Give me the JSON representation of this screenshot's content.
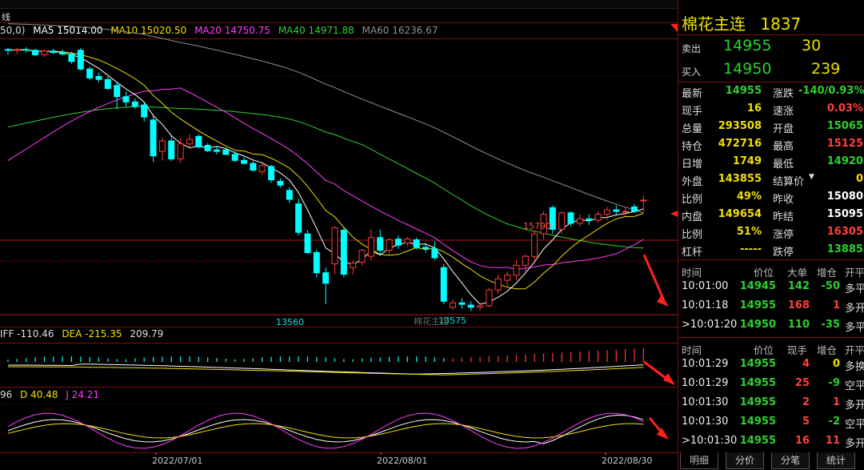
{
  "indicators": {
    "main_prefix": "50,0)",
    "ma5": "MA5 15014.00",
    "ma10": "MA10 15020.50",
    "ma20": "MA20 14750.75",
    "ma40": "MA40 14971.88",
    "ma60": "MA60 16236.67",
    "toolbar_text": "线",
    "macd_prefix": "IFF -110.46",
    "dea": "DEA -215.35",
    "macd": "209.79",
    "kdj_prefix": "96",
    "kdj_d": "D 40.48",
    "kdj_j": "J 24.21"
  },
  "annotations": {
    "high": "15790",
    "low1": "13560",
    "low2": "13575",
    "watermark": "棉花主连"
  },
  "dates": [
    "2022/07/01",
    "2022/08/01",
    "2022/08/30"
  ],
  "colors": {
    "up": "#ff3b3b",
    "down": "#00ffff",
    "ma5": "#ffffff",
    "ma10": "#f0e000",
    "ma20": "#ff3cff",
    "ma40": "#30d030",
    "ma60": "#909090",
    "border": "#7a1010"
  },
  "chart_data": {
    "type": "candlestick",
    "dates": [
      "2022/07/01",
      "2022/08/01",
      "2022/08/30"
    ],
    "candles": [
      [
        16960,
        16980,
        16890,
        16950
      ],
      [
        16950,
        16980,
        16900,
        16960
      ],
      [
        16960,
        16990,
        16920,
        16950
      ],
      [
        16950,
        16970,
        16870,
        16890
      ],
      [
        16890,
        16960,
        16860,
        16940
      ],
      [
        16940,
        16970,
        16900,
        16920
      ],
      [
        16920,
        16960,
        16880,
        16900
      ],
      [
        16900,
        16930,
        16770,
        16800
      ],
      [
        16950,
        16980,
        16680,
        16700
      ],
      [
        16700,
        16730,
        16550,
        16580
      ],
      [
        16600,
        16650,
        16520,
        16560
      ],
      [
        16560,
        16600,
        16420,
        16440
      ],
      [
        16480,
        16520,
        16160,
        16330
      ],
      [
        16330,
        16400,
        16200,
        16260
      ],
      [
        16260,
        16310,
        16170,
        16200
      ],
      [
        16220,
        16250,
        16000,
        16060
      ],
      [
        16020,
        16100,
        15460,
        15540
      ],
      [
        15600,
        15780,
        15480,
        15740
      ],
      [
        15740,
        15800,
        15470,
        15500
      ],
      [
        15500,
        15770,
        15450,
        15700
      ],
      [
        15700,
        15830,
        15630,
        15760
      ],
      [
        15800,
        15830,
        15640,
        15660
      ],
      [
        15680,
        15710,
        15590,
        15610
      ],
      [
        15620,
        15670,
        15560,
        15600
      ],
      [
        15620,
        15640,
        15550,
        15560
      ],
      [
        15560,
        15600,
        15460,
        15480
      ],
      [
        15480,
        15520,
        15420,
        15440
      ],
      [
        15440,
        15470,
        15330,
        15350
      ],
      [
        15330,
        15440,
        15280,
        15410
      ],
      [
        15400,
        15420,
        15180,
        15220
      ],
      [
        15200,
        15240,
        15120,
        15150
      ],
      [
        15080,
        15120,
        14910,
        14960
      ],
      [
        14900,
        14970,
        14480,
        14520
      ],
      [
        14500,
        14550,
        14230,
        14250
      ],
      [
        14250,
        14290,
        13920,
        13980
      ],
      [
        13980,
        14050,
        13560,
        13840
      ],
      [
        14100,
        14600,
        13960,
        14580
      ],
      [
        14550,
        14580,
        13920,
        13960
      ],
      [
        14050,
        14150,
        13960,
        14110
      ],
      [
        14120,
        14300,
        14080,
        14280
      ],
      [
        14200,
        14560,
        14150,
        14450
      ],
      [
        14450,
        14560,
        14220,
        14280
      ],
      [
        14280,
        14440,
        14230,
        14420
      ],
      [
        14430,
        14480,
        14300,
        14350
      ],
      [
        14380,
        14460,
        14330,
        14430
      ],
      [
        14420,
        14450,
        14290,
        14320
      ],
      [
        14320,
        14380,
        14250,
        14300
      ],
      [
        14300,
        14400,
        14150,
        14180
      ],
      [
        14050,
        14100,
        13560,
        13600
      ],
      [
        13520,
        13620,
        13480,
        13580
      ],
      [
        13580,
        13640,
        13500,
        13560
      ],
      [
        13550,
        13600,
        13470,
        13520
      ],
      [
        13520,
        13580,
        13480,
        13540
      ],
      [
        13540,
        13780,
        13520,
        13750
      ],
      [
        13750,
        13950,
        13700,
        13900
      ],
      [
        13880,
        14000,
        13800,
        13950
      ],
      [
        13950,
        14150,
        13880,
        14080
      ],
      [
        14080,
        14220,
        13980,
        14200
      ],
      [
        14200,
        14550,
        14150,
        14500
      ],
      [
        14500,
        14800,
        14430,
        14760
      ],
      [
        14850,
        14880,
        14500,
        14560
      ],
      [
        14560,
        14800,
        14500,
        14780
      ],
      [
        14780,
        14800,
        14600,
        14640
      ],
      [
        14640,
        14760,
        14600,
        14700
      ],
      [
        14700,
        14760,
        14620,
        14680
      ],
      [
        14680,
        14800,
        14650,
        14760
      ],
      [
        14760,
        14860,
        14680,
        14820
      ],
      [
        14820,
        14880,
        14760,
        14800
      ],
      [
        14800,
        14860,
        14740,
        14800
      ],
      [
        14860,
        14900,
        14780,
        14800
      ],
      [
        14950,
        15010,
        14800,
        14950
      ]
    ]
  },
  "panel": {
    "title": "棉花主连",
    "code": "1837",
    "sell": {
      "label": "卖出",
      "price": "14955",
      "vol": "30"
    },
    "buy": {
      "label": "买入",
      "price": "14950",
      "vol": "239"
    },
    "stats": [
      {
        "l1": "最新",
        "v1": "14955",
        "c1": "#2ed12e",
        "l2": "涨跌",
        "v2": "-140/0.93%",
        "c2": "#2ed12e"
      },
      {
        "l1": "现手",
        "v1": "16",
        "c1": "#f0e000",
        "l2": "速涨",
        "v2": "0.03%",
        "c2": "#ff4040"
      },
      {
        "l1": "总量",
        "v1": "293508",
        "c1": "#f0e000",
        "l2": "开盘",
        "v2": "15065",
        "c2": "#2ed12e"
      },
      {
        "l1": "持仓",
        "v1": "472716",
        "c1": "#f0e000",
        "l2": "最高",
        "v2": "15125",
        "c2": "#ff4040"
      },
      {
        "l1": "日增",
        "v1": "1749",
        "c1": "#f0e000",
        "l2": "最低",
        "v2": "14920",
        "c2": "#2ed12e"
      },
      {
        "l1": "外盘",
        "v1": "143855",
        "c1": "#f0e000",
        "l2": "结算价",
        "v2": "0",
        "c2": "#f0e000"
      },
      {
        "l1": "比例",
        "v1": "49%",
        "c1": "#f0e000",
        "l2": "昨收",
        "v2": "15080",
        "c2": "#ffffff"
      },
      {
        "l1": "内盘",
        "v1": "149654",
        "c1": "#f0e000",
        "l2": "昨结",
        "v2": "15095",
        "c2": "#ffffff"
      },
      {
        "l1": "比例",
        "v1": "51%",
        "c1": "#f0e000",
        "l2": "涨停",
        "v2": "16305",
        "c2": "#ff4040"
      },
      {
        "l1": "杠杆",
        "v1": "-----",
        "c1": "#f0e000",
        "l2": "跌停",
        "v2": "13885",
        "c2": "#2ed12e"
      }
    ],
    "thead1": {
      "time": "时间",
      "price": "价位",
      "vol": "大单",
      "chg": "增仓",
      "kind": "开平"
    },
    "trades1": [
      {
        "time": "10:01:00",
        "price": "14945",
        "vol": "142",
        "chg": "-50",
        "kind": "多平",
        "vc": "#2ed12e",
        "cc": "#2ed12e"
      },
      {
        "time": "10:01:18",
        "price": "14955",
        "vol": "168",
        "chg": "1",
        "kind": "多开",
        "vc": "#ff4040",
        "cc": "#ff4040"
      },
      {
        "time": ">10:01:20",
        "price": "14950",
        "vol": "110",
        "chg": "-35",
        "kind": "多平",
        "vc": "#2ed12e",
        "cc": "#2ed12e"
      }
    ],
    "thead2": {
      "time": "时间",
      "price": "价位",
      "vol": "现手",
      "chg": "增仓",
      "kind": "开平"
    },
    "trades2": [
      {
        "time": "10:01:29",
        "price": "14955",
        "vol": "4",
        "chg": "0",
        "kind": "多换",
        "vc": "#ff4040",
        "cc": "#f0e000"
      },
      {
        "time": "10:01:29",
        "price": "14955",
        "vol": "25",
        "chg": "-9",
        "kind": "空平",
        "vc": "#ff4040",
        "cc": "#2ed12e"
      },
      {
        "time": "10:01:30",
        "price": "14955",
        "vol": "2",
        "chg": "1",
        "kind": "多开",
        "vc": "#ff4040",
        "cc": "#ff4040"
      },
      {
        "time": "10:01:30",
        "price": "14955",
        "vol": "5",
        "chg": "-2",
        "kind": "空平",
        "vc": "#ff4040",
        "cc": "#2ed12e"
      },
      {
        "time": ">10:01:30",
        "price": "14955",
        "vol": "16",
        "chg": "11",
        "kind": "多开",
        "vc": "#ff4040",
        "cc": "#ff4040"
      }
    ],
    "tabs": [
      "明细",
      "分价",
      "分笔",
      "统计"
    ]
  }
}
